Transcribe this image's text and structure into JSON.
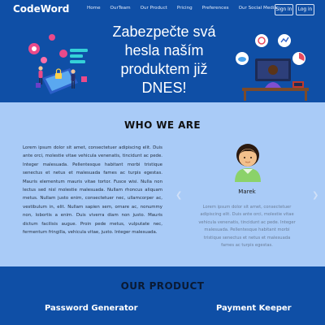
{
  "brand": "CodeWord",
  "nav": {
    "links": [
      "Home",
      "OurTeam",
      "Our Product",
      "Pricing",
      "Preferences",
      "Our Social Media"
    ],
    "signin_label": "Sign In",
    "login_label": "Log in"
  },
  "hero": {
    "title": "Zabezpečte svá hesla naším produktem již DNES!"
  },
  "who": {
    "title": "WHO WE ARE",
    "text": "Lorem ipsum dolor sit amet, consectetuer adipiscing elit. Duis ante orci, molestie vitae vehicula venenatis, tincidunt ac pede. Integer malesuada. Pellentesque habitant morbi tristique senectus et netus et malesuada fames ac turpis egestas. Mauris elementum mauris vitae tortor. Fusce wisi. Nulla non lectus sed nisl molestie malesuada. Nullam rhoncus aliquam metus. Nullam justo enim, consectetuer nec, ullamcorper ac, vestibulum in, elit. Nullam sapien sem, ornare ac, nonummy non, lobortis a enim. Duis viverra diam non justo. Mauris dictum facilisis augue. Proin pede metus, vulputate nec, fermentum fringilla, vehicula vitae, justo. Integer malesuada.",
    "carousel": {
      "name": "Marek",
      "text": "Lorem ipsum dolor sit amet, consectetuer adipiscing elit. Duis ante orci, molestie vitae vehicula venenatis, tincidunt ac pede. Integer malesuada. Pellentesque habitant morbi tristique senectus et netus et malesuada fames ac turpis egestas.",
      "prev_icon": "chevron-left-icon",
      "next_icon": "chevron-right-icon"
    }
  },
  "product": {
    "title": "OUR PRODUCT",
    "items": [
      "Password Generator",
      "Payment Keeper"
    ]
  },
  "colors": {
    "primary_blue": "#0f4fa6",
    "light_blue": "#a9cbf7"
  }
}
